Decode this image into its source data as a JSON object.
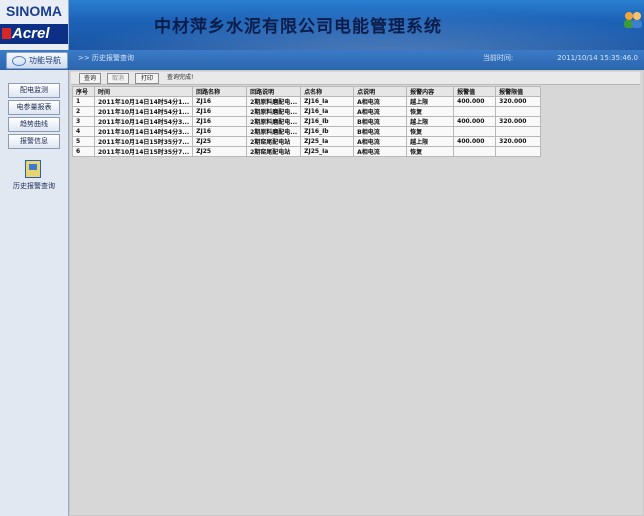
{
  "brand": {
    "sinoma": "SINOMA",
    "acrel": "Acrel"
  },
  "header": {
    "title": "中材萍乡水泥有限公司电能管理系统",
    "icon_users": "users-icon",
    "icon_home": "home-icon"
  },
  "nav": {
    "tab_label": "功能导航"
  },
  "breadcrumb": ">> 历史报警查询",
  "time": {
    "label": "当前时间:",
    "value": "2011/10/14 15:35:46.0"
  },
  "sidebar": {
    "buttons": [
      "配电监测",
      "电参量报表",
      "趋势曲线",
      "报警信息"
    ],
    "history_label": "历史报警查询"
  },
  "toolbar": {
    "query": "查询",
    "cancel": "取消",
    "print": "打印",
    "status": "查询完成!"
  },
  "table": {
    "headers": [
      "序号",
      "时间",
      "回路名称",
      "回路说明",
      "点名称",
      "点说明",
      "报警内容",
      "报警值",
      "报警限值"
    ],
    "rows": [
      [
        "1",
        "2011年10月14日14时54分1...",
        "ZJ16",
        "2期原料磨配电...",
        "ZJ16_Ia",
        "A相电流",
        "越上限",
        "400.000",
        "320.000"
      ],
      [
        "2",
        "2011年10月14日14时54分1...",
        "ZJ16",
        "2期原料磨配电...",
        "ZJ16_Ia",
        "A相电流",
        "恢复",
        "",
        ""
      ],
      [
        "3",
        "2011年10月14日14时54分3...",
        "ZJ16",
        "2期原料磨配电...",
        "ZJ16_Ib",
        "B相电流",
        "越上限",
        "400.000",
        "320.000"
      ],
      [
        "4",
        "2011年10月14日14时54分3...",
        "ZJ16",
        "2期原料磨配电...",
        "ZJ16_Ib",
        "B相电流",
        "恢复",
        "",
        ""
      ],
      [
        "5",
        "2011年10月14日15时35分7...",
        "ZJ25",
        "2期窑尾配电站",
        "ZJ25_Ia",
        "A相电流",
        "越上限",
        "400.000",
        "320.000"
      ],
      [
        "6",
        "2011年10月14日15时35分7...",
        "ZJ25",
        "2期窑尾配电站",
        "ZJ25_Ia",
        "A相电流",
        "恢复",
        "",
        ""
      ]
    ]
  }
}
